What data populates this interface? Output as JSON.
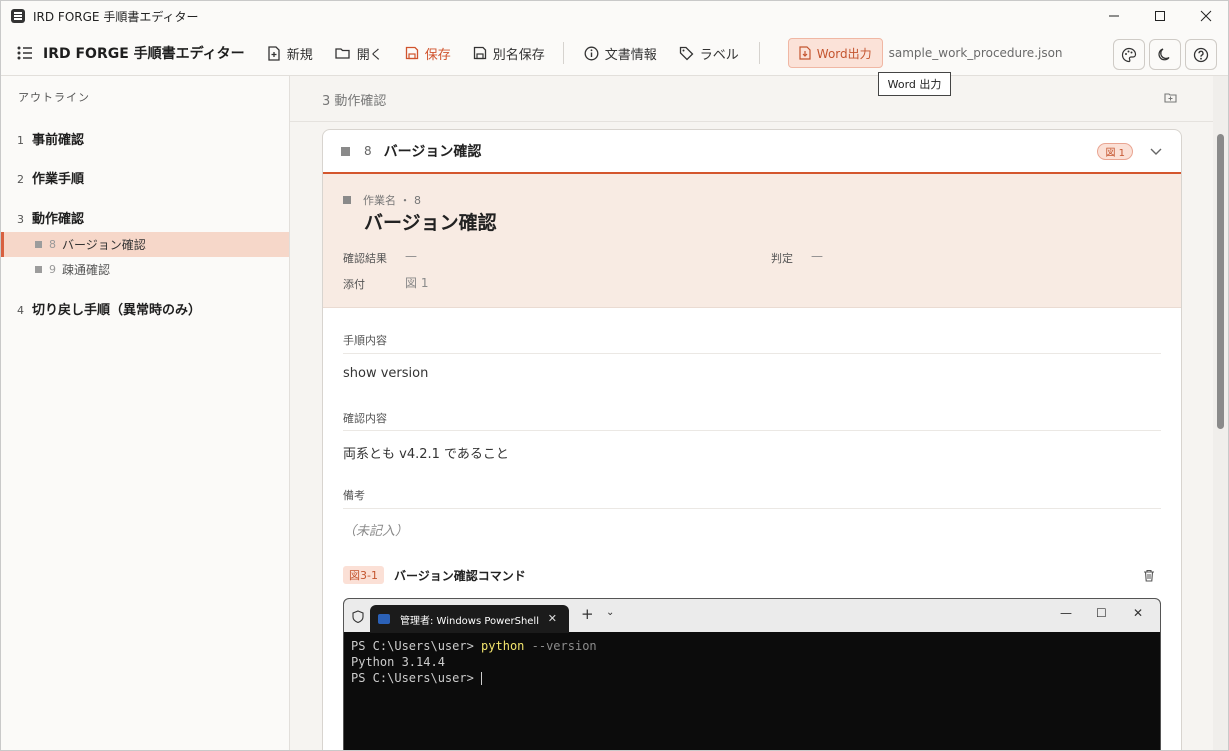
{
  "window": {
    "title": "IRD FORGE 手順書エディター"
  },
  "toolbar": {
    "brand": "IRD FORGE 手順書エディター",
    "new_label": "新規",
    "open_label": "開く",
    "save_label": "保存",
    "saveas_label": "別名保存",
    "docinfo_label": "文書情報",
    "label_label": "ラベル",
    "word_label": "Word出力",
    "filename": "sample_work_procedure.json"
  },
  "tooltip": {
    "text": "Word 出力"
  },
  "sidebar": {
    "title": "アウトライン",
    "items": [
      {
        "num": "1",
        "label": "事前確認"
      },
      {
        "num": "2",
        "label": "作業手順"
      },
      {
        "num": "3",
        "label": "動作確認"
      },
      {
        "num": "4",
        "label": "切り戻し手順（異常時のみ）"
      }
    ],
    "subitems": [
      {
        "num": "8",
        "label": "バージョン確認"
      },
      {
        "num": "9",
        "label": "疎通確認"
      }
    ]
  },
  "section": {
    "label": "3 動作確認"
  },
  "card": {
    "num": "8",
    "title": "バージョン確認",
    "fig_badge": "図 1",
    "meta": "作業名 ・ 8",
    "big_title": "バージョン確認",
    "result_label": "確認結果",
    "result_value": "—",
    "judge_label": "判定",
    "judge_value": "—",
    "attach_label": "添付",
    "attach_value": "図 1",
    "proc_label": "手順内容",
    "proc_text": "show version",
    "check_label": "確認内容",
    "check_text": "両系とも v4.2.1 であること",
    "note_label": "備考",
    "note_text": "（未記入）",
    "fig_tag": "図3-1",
    "fig_title": "バージョン確認コマンド"
  },
  "terminal": {
    "tab_title": "管理者: Windows PowerShell",
    "line1_prompt": "PS C:\\Users\\user> ",
    "line1_cmd": "python",
    "line1_arg": " --version",
    "line2": "Python 3.14.4",
    "line3_prompt": "PS C:\\Users\\user> "
  }
}
